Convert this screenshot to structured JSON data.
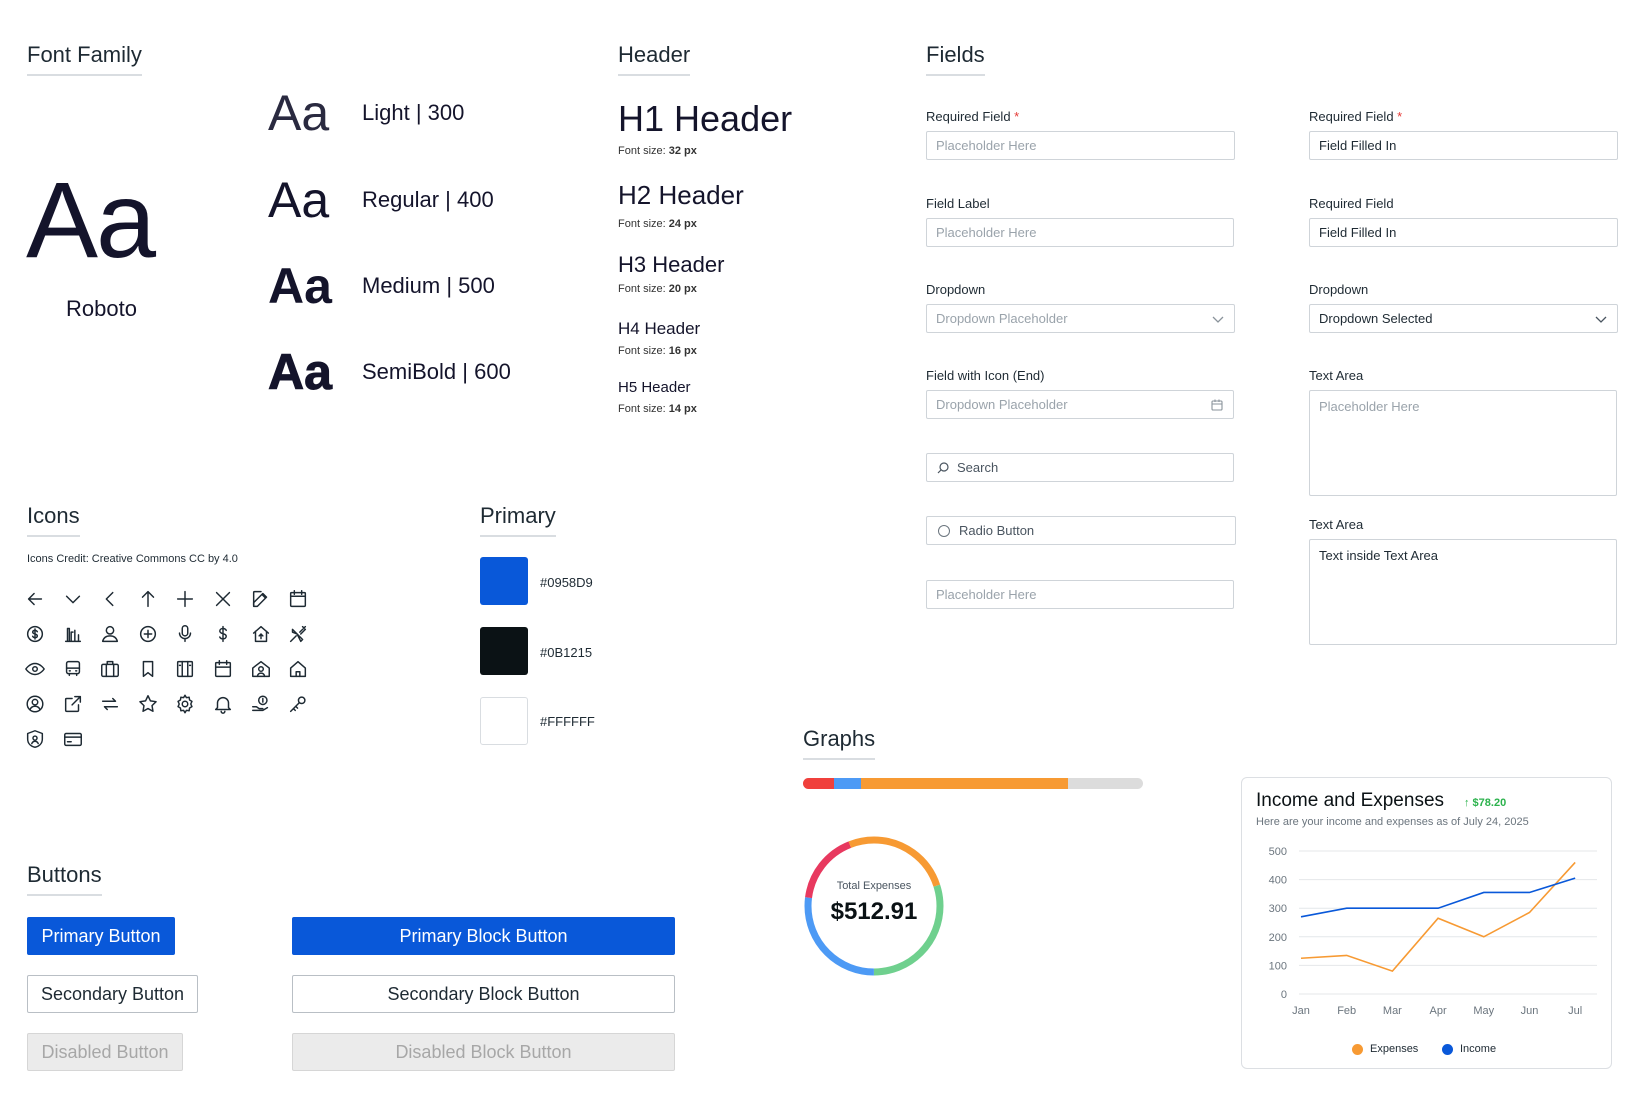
{
  "font_section": {
    "title": "Font Family",
    "sample": "Aa",
    "font_name": "Roboto",
    "weights": [
      {
        "sample": "Aa",
        "label": "Light | 300"
      },
      {
        "sample": "Aa",
        "label": "Regular | 400"
      },
      {
        "sample": "Aa",
        "label": "Medium | 500"
      },
      {
        "sample": "Aa",
        "label": "SemiBold | 600"
      }
    ]
  },
  "header_section": {
    "title": "Header",
    "items": [
      {
        "text": "H1 Header",
        "size_label": "Font size: ",
        "size_value": "32 px"
      },
      {
        "text": "H2 Header",
        "size_label": "Font size: ",
        "size_value": "24 px"
      },
      {
        "text": "H3 Header",
        "size_label": "Font size: ",
        "size_value": "20 px"
      },
      {
        "text": "H4 Header",
        "size_label": "Font size: ",
        "size_value": "16 px"
      },
      {
        "text": "H5 Header",
        "size_label": "Font size: ",
        "size_value": "14 px"
      }
    ]
  },
  "fields_section": {
    "title": "Fields",
    "left": {
      "required_label": "Required Field",
      "required_star": "*",
      "required_placeholder": "Placeholder Here",
      "field_label": "Field Label",
      "field_placeholder": "Placeholder Here",
      "dropdown_label": "Dropdown",
      "dropdown_placeholder": "Dropdown Placeholder",
      "icon_field_label": "Field with Icon (End)",
      "icon_field_placeholder": "Dropdown Placeholder",
      "search_placeholder": "Search",
      "radio_label": "Radio Button",
      "plain_placeholder": "Placeholder Here"
    },
    "right": {
      "required_label": "Required Field",
      "required_star": "*",
      "required_value": "Field Filled In",
      "required2_label": "Required Field",
      "required2_value": "Field Filled In",
      "dropdown_label": "Dropdown",
      "dropdown_value": "Dropdown Selected",
      "textarea_label": "Text Area",
      "textarea_placeholder": "Placeholder Here",
      "textarea2_label": "Text Area",
      "textarea2_value": "Text inside Text Area"
    }
  },
  "icons_section": {
    "title": "Icons",
    "credit": "Icons Credit: Creative Commons CC by 4.0",
    "icons": [
      "arrow-left-icon",
      "chevron-down-icon",
      "chevron-left-icon",
      "arrow-up-icon",
      "plus-icon",
      "close-icon",
      "edit-icon",
      "calendar-icon",
      "dollar-circle-icon",
      "bar-chart-icon",
      "user-icon",
      "plus-circle-icon",
      "microphone-icon",
      "dollar-icon",
      "home-up-icon",
      "airplane-icon",
      "eye-icon",
      "bus-icon",
      "briefcase-icon",
      "bookmark-icon",
      "book-icon",
      "calendar-grid-icon",
      "user-home-icon",
      "home-icon",
      "user-circle-icon",
      "external-link-icon",
      "swap-icon",
      "star-icon",
      "gear-icon",
      "bell-icon",
      "money-hand-icon",
      "key-icon",
      "shield-user-icon",
      "credit-card-icon"
    ]
  },
  "primary_section": {
    "title": "Primary",
    "colors": [
      {
        "hex": "#0958D9",
        "label": "#0958D9"
      },
      {
        "hex": "#0B1215",
        "label": "#0B1215"
      },
      {
        "hex": "#FFFFFF",
        "label": "#FFFFFF"
      }
    ]
  },
  "buttons_section": {
    "title": "Buttons",
    "primary": "Primary Button",
    "secondary": "Secondary Button",
    "disabled": "Disabled Button",
    "primary_block": "Primary Block Button",
    "secondary_block": "Secondary Block Button",
    "disabled_block": "Disabled Block Button"
  },
  "graphs_section": {
    "title": "Graphs",
    "progress_segments": [
      {
        "color": "#f0403c",
        "fraction": 0.09
      },
      {
        "color": "#4d9af5",
        "fraction": 0.08
      },
      {
        "color": "#f79a33",
        "fraction": 0.61
      }
    ],
    "donut": {
      "label": "Total Expenses",
      "value": "$512.91",
      "segments": [
        {
          "color": "#f79a33",
          "fraction": 0.2
        },
        {
          "color": "#6fd08e",
          "fraction": 0.3
        },
        {
          "color": "#4d9af5",
          "fraction": 0.27
        },
        {
          "color": "#e8395f",
          "fraction": 0.17
        },
        {
          "color": "#f79a33",
          "fraction": 0.06
        }
      ]
    }
  },
  "chart_data": {
    "type": "line",
    "title": "Income and Expenses",
    "delta": "↑ $78.20",
    "subtitle": "Here are your income and expenses as of July 24, 2025",
    "categories": [
      "Jan",
      "Feb",
      "Mar",
      "Apr",
      "May",
      "Jun",
      "Jul"
    ],
    "ylim": [
      0,
      500
    ],
    "yticks": [
      0,
      100,
      200,
      300,
      400,
      500
    ],
    "grid": true,
    "legend_position": "bottom",
    "series": [
      {
        "name": "Expenses",
        "color": "#f79a33",
        "values": [
          125,
          135,
          80,
          265,
          200,
          285,
          460
        ]
      },
      {
        "name": "Income",
        "color": "#0958D9",
        "values": [
          270,
          300,
          300,
          300,
          355,
          355,
          405
        ]
      }
    ]
  }
}
